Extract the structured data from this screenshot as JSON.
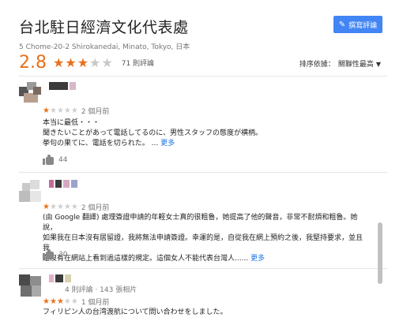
{
  "place": {
    "title": "台北駐日經濟文化代表處",
    "address": "5 Chome-20-2 Shirokanedai, Minato, Tokyo, 日本"
  },
  "actions": {
    "write_review_label": "撰寫評論",
    "write_review_icon": "pencil-icon"
  },
  "summary": {
    "rating": "2.8",
    "stars_filled": 3,
    "review_count": "71 則評論",
    "sort_label": "排序依據：",
    "sort_value": "關聯性最高"
  },
  "reviews": [
    {
      "stars": 1,
      "date": "2 個月前",
      "text_lines": [
        "本当に最低・・・",
        "聞きたいことがあって電話してるのに、男性スタッフの態度が横柄。",
        "挙句の果てに、電話を切られた。"
      ],
      "more": "更多",
      "likes": "44"
    },
    {
      "stars": 1,
      "date": "2 個月前",
      "text_lines": [
        "(由 Google 翻譯) 處理簽證申請的年輕女士真的很粗魯，她提高了他的聲音，非常不耐煩和粗魯。她說，",
        "如果我在日本沒有居留證，我將無法申請簽證。幸運的是，自從我在網上預約之後，我堅持要求，並且我",
        "還沒有在網站上看到過這樣的規定。這個女人不能代表台灣人......"
      ],
      "more": "更多",
      "likes": "30"
    },
    {
      "reviewer_stats": "4 則評論 · 143 張相片",
      "stars": 3,
      "date": "1 個月前",
      "text_lines": [
        "フィリピン人の台湾渡航について問い合わせをしました。"
      ]
    }
  ],
  "colors": {
    "accent": "#e7711b",
    "link": "#1a73e8",
    "button": "#4285f4"
  }
}
